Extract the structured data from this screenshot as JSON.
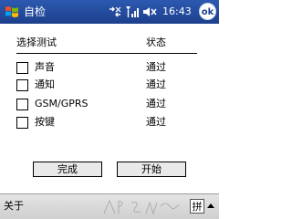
{
  "title_bar": {
    "title": "自检",
    "clock": "16:43",
    "ok_label": "ok"
  },
  "icons": {
    "start": "windows-flag-icon",
    "connectivity": "connectivity-icon",
    "signal": "signal-strength-icon",
    "volume": "volume-muted-icon"
  },
  "table": {
    "header_test": "选择测试",
    "header_status": "状态",
    "rows": [
      {
        "name": "声音",
        "status": "通过",
        "checked": false
      },
      {
        "name": "通知",
        "status": "通过",
        "checked": false
      },
      {
        "name": "GSM/GPRS",
        "status": "通过",
        "checked": false
      },
      {
        "name": "按键",
        "status": "通过",
        "checked": false
      }
    ]
  },
  "buttons": {
    "done": "完成",
    "start": "开始"
  },
  "menu_bar": {
    "left_menu": "关于",
    "ime_label": "拼"
  },
  "colors": {
    "title_bar": "#1d3f8c",
    "menu_bar": "#d6d6d6",
    "button_face": "#e9e9e9"
  }
}
